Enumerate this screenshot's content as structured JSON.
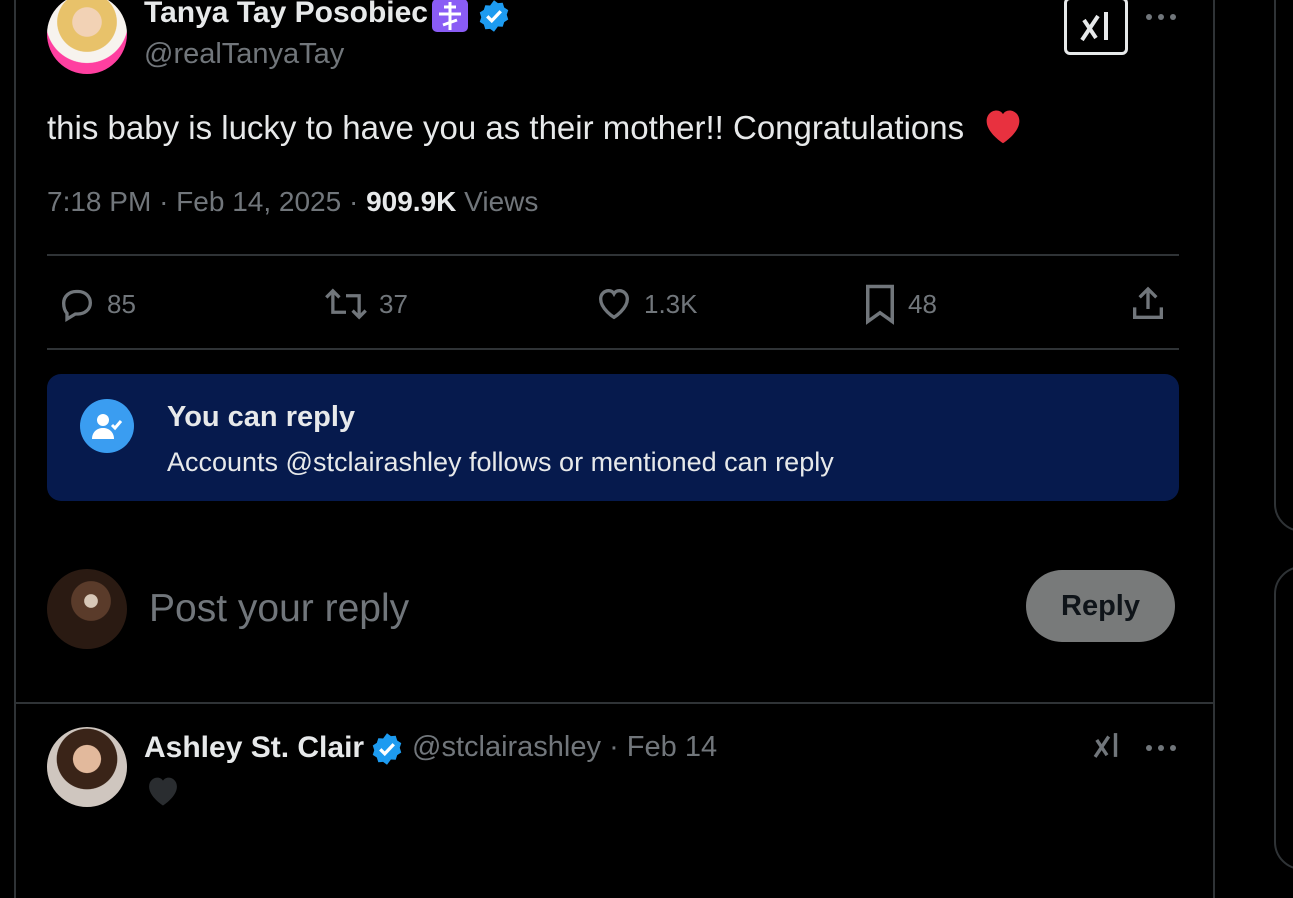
{
  "tweet": {
    "author_name": "Tanya Tay Posobiec",
    "author_handle": "@realTanyaTay",
    "text": "this baby is lucky to have you as their mother!! Congratulations",
    "emoji": "❤️",
    "time": "7:18 PM",
    "separator": "·",
    "date": "Feb 14, 2025",
    "views_count": "909.9K",
    "views_label": "Views"
  },
  "actions": {
    "replies": "85",
    "reposts": "37",
    "likes": "1.3K",
    "bookmarks": "48"
  },
  "reply_notice": {
    "title": "You can reply",
    "subtitle": "Accounts @stclairashley follows or mentioned can reply"
  },
  "composer": {
    "placeholder": "Post your reply",
    "button_label": "Reply"
  },
  "reply_tweet": {
    "author_name": "Ashley St. Clair",
    "author_handle": "@stclairashley",
    "separator": "·",
    "date": "Feb 14",
    "emoji": "🖤"
  },
  "colors": {
    "background": "#000000",
    "verified": "#1d9bf0",
    "banner": "#061a4d",
    "heart": "#e8313f",
    "cross_badge": "#8a5cf5"
  },
  "icons": [
    "verified-badge-icon",
    "orthodox-cross-icon",
    "grok-icon",
    "more-icon",
    "reply-icon",
    "repost-icon",
    "like-icon",
    "bookmark-icon",
    "share-icon",
    "user-check-icon"
  ]
}
